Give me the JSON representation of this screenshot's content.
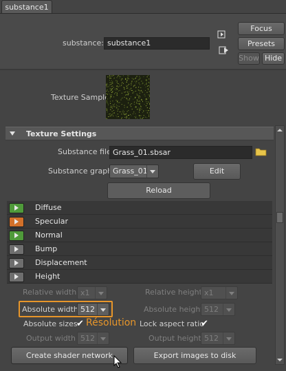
{
  "tab": {
    "label": "substance1"
  },
  "header": {
    "substance_label": "substance:",
    "substance_value": "substance1",
    "focus_label": "Focus",
    "presets_label": "Presets",
    "show_label": "Show",
    "hide_label": "Hide"
  },
  "sample": {
    "label": "Texture Sample"
  },
  "texture_settings": {
    "title": "Texture Settings",
    "file_label": "Substance file",
    "file_value": "Grass_01.sbsar",
    "graph_label": "Substance graph",
    "graph_value": "Grass_01",
    "edit_label": "Edit",
    "reload_label": "Reload"
  },
  "outputs": [
    {
      "label": "Diffuse",
      "icon": "green-play-icon",
      "color": "#4f9a3a"
    },
    {
      "label": "Specular",
      "icon": "orange-play-icon",
      "color": "#d2702a"
    },
    {
      "label": "Normal",
      "icon": "green-play-icon",
      "color": "#4f9a3a"
    },
    {
      "label": "Bump",
      "icon": "grey-play-icon",
      "color": "#6e6e6e"
    },
    {
      "label": "Displacement",
      "icon": "grey-play-icon",
      "color": "#6e6e6e"
    },
    {
      "label": "Height",
      "icon": "grey-play-icon",
      "color": "#6e6e6e"
    }
  ],
  "size": {
    "relative_width_label": "Relative width",
    "relative_width_value": "x1",
    "relative_height_label": "Relative height",
    "relative_height_value": "x1",
    "absolute_width_label": "Absolute width",
    "absolute_width_value": "512",
    "absolute_height_label": "Absolute height",
    "absolute_height_value": "512",
    "absolute_sizes_label": "Absolute sizes",
    "lock_aspect_label": "Lock aspect ratio",
    "output_width_label": "Output width",
    "output_width_value": "512",
    "output_height_label": "Output height",
    "output_height_value": "512",
    "annotation": "Résolution",
    "annotation_color": "#e8962a"
  },
  "actions": {
    "create_label": "Create shader network",
    "export_label": "Export images to disk"
  }
}
